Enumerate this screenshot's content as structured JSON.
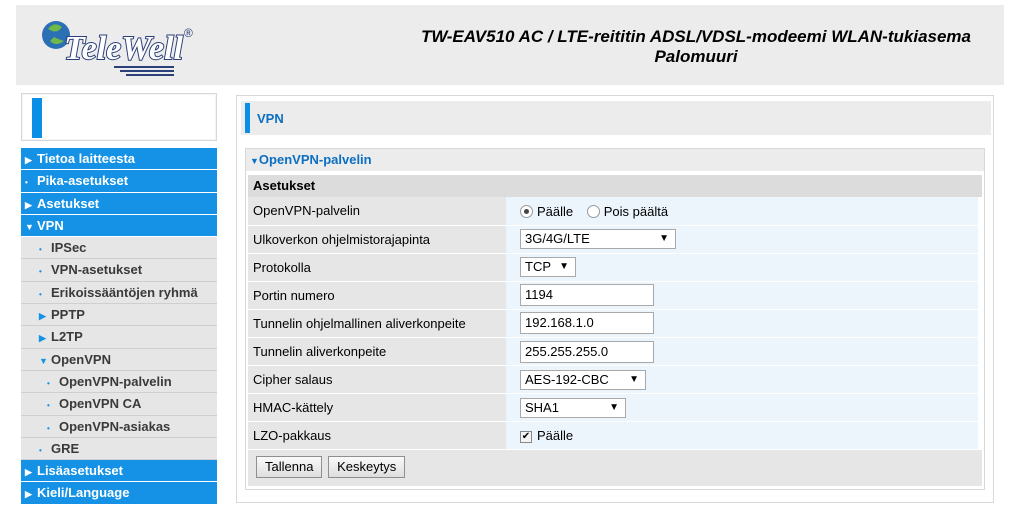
{
  "header": {
    "logo_text": "TeleWell",
    "title": "TW-EAV510 AC / LTE-reititin ADSL/VDSL-modeemi WLAN-tukiasema Palomuuri"
  },
  "menu": [
    {
      "label": "Tietoa laitteesta",
      "level": "top",
      "marker": "▶"
    },
    {
      "label": "Pika-asetukset",
      "level": "top",
      "marker": "•"
    },
    {
      "label": "Asetukset",
      "level": "top",
      "marker": "▶"
    },
    {
      "label": "VPN",
      "level": "top",
      "marker": "▼"
    },
    {
      "label": "IPSec",
      "level": "l1",
      "marker": "•"
    },
    {
      "label": "VPN-asetukset",
      "level": "l1",
      "marker": "•"
    },
    {
      "label": "Erikoissääntöjen ryhmä",
      "level": "l1",
      "marker": "•"
    },
    {
      "label": "PPTP",
      "level": "l1",
      "marker": "▶"
    },
    {
      "label": "L2TP",
      "level": "l1",
      "marker": "▶"
    },
    {
      "label": "OpenVPN",
      "level": "l1",
      "marker": "▼"
    },
    {
      "label": "OpenVPN-palvelin",
      "level": "l2",
      "marker": "•"
    },
    {
      "label": "OpenVPN CA",
      "level": "l2",
      "marker": "•"
    },
    {
      "label": "OpenVPN-asiakas",
      "level": "l2",
      "marker": "•"
    },
    {
      "label": "GRE",
      "level": "l1",
      "marker": "•"
    },
    {
      "label": "Lisäasetukset",
      "level": "top",
      "marker": "▶"
    },
    {
      "label": "Kieli/Language",
      "level": "top",
      "marker": "▶"
    }
  ],
  "page": {
    "title": "VPN",
    "panel_title": "OpenVPN-palvelin",
    "section": "Asetukset"
  },
  "form": {
    "server_label": "OpenVPN-palvelin",
    "server_on": "Päälle",
    "server_off": "Pois päältä",
    "wan_label": "Ulkoverkon ohjelmistorajapinta",
    "wan_value": "3G/4G/LTE",
    "proto_label": "Protokolla",
    "proto_value": "TCP",
    "port_label": "Portin numero",
    "port_value": "1194",
    "vsubnet_label": "Tunnelin ohjelmallinen aliverkonpeite",
    "vsubnet_value": "192.168.1.0",
    "mask_label": "Tunnelin aliverkonpeite",
    "mask_value": "255.255.255.0",
    "cipher_label": "Cipher salaus",
    "cipher_value": "AES-192-CBC",
    "hmac_label": "HMAC-kättely",
    "hmac_value": "SHA1",
    "lzo_label": "LZO-pakkaus",
    "lzo_value": "Päälle"
  },
  "buttons": {
    "save": "Tallenna",
    "cancel": "Keskeytys"
  },
  "icons": {
    "expanded": "▼",
    "dropdown": "▼",
    "check": "✔"
  },
  "colors": {
    "accent": "#1592e6",
    "header_bg": "#ececec"
  }
}
